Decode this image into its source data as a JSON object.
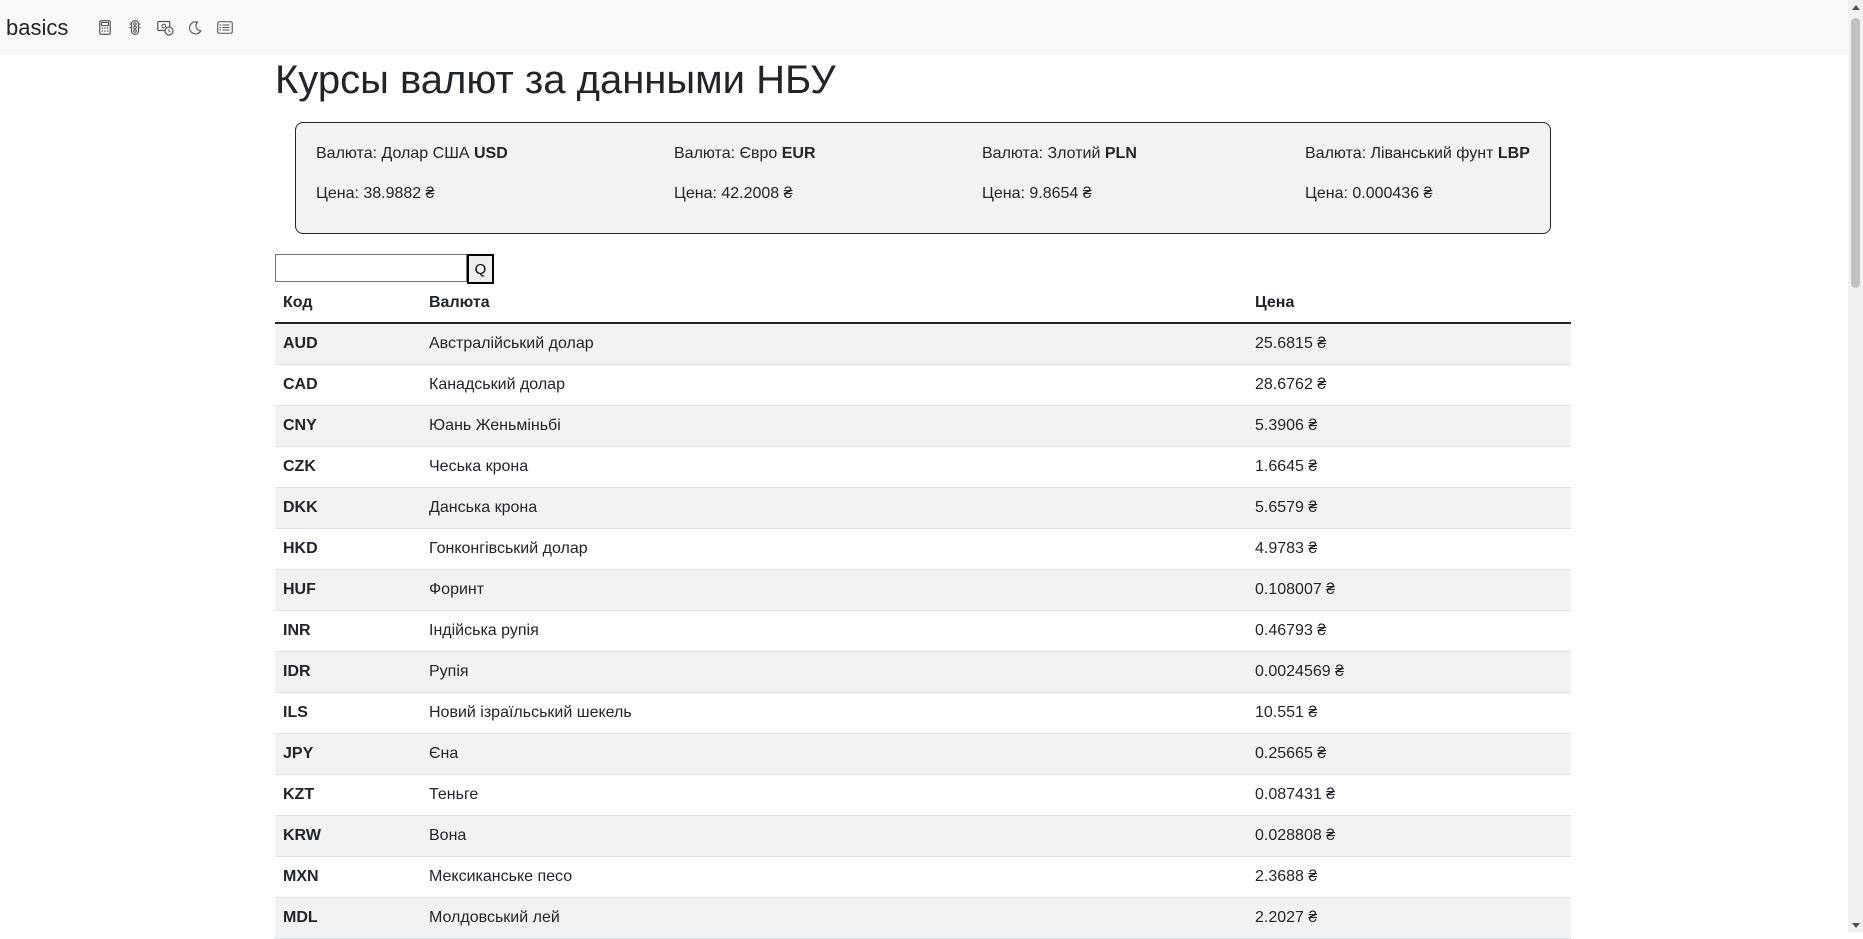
{
  "navbar": {
    "brand": "basics",
    "icons": [
      "calculator-icon",
      "traffic-light-icon",
      "currency-exchange-icon",
      "moon-icon",
      "card-list-icon"
    ]
  },
  "page": {
    "title": "Курсы валют за данными НБУ"
  },
  "featured": [
    {
      "label": "Валюта: Долар США ",
      "code": "USD",
      "price": "Цена: 38.9882 ₴"
    },
    {
      "label": "Валюта: Євро ",
      "code": "EUR",
      "price": "Цена: 42.2008 ₴"
    },
    {
      "label": "Валюта: Злотий ",
      "code": "PLN",
      "price": "Цена: 9.8654 ₴"
    },
    {
      "label": "Валюта: Ліванський фунт ",
      "code": "LBP",
      "price": "Цена: 0.000436 ₴"
    }
  ],
  "search": {
    "value": "",
    "button_label": "Q"
  },
  "table": {
    "headers": [
      "Код",
      "Валюта",
      "Цена"
    ],
    "rows": [
      {
        "code": "AUD",
        "name": "Австралійський долар",
        "price": "25.6815 ₴"
      },
      {
        "code": "CAD",
        "name": "Канадський долар",
        "price": "28.6762 ₴"
      },
      {
        "code": "CNY",
        "name": "Юань Женьміньбі",
        "price": "5.3906 ₴"
      },
      {
        "code": "CZK",
        "name": "Чеська крона",
        "price": "1.6645 ₴"
      },
      {
        "code": "DKK",
        "name": "Данська крона",
        "price": "5.6579 ₴"
      },
      {
        "code": "HKD",
        "name": "Гонконгівський долар",
        "price": "4.9783 ₴"
      },
      {
        "code": "HUF",
        "name": "Форинт",
        "price": "0.108007 ₴"
      },
      {
        "code": "INR",
        "name": "Індійська рупія",
        "price": "0.46793 ₴"
      },
      {
        "code": "IDR",
        "name": "Рупія",
        "price": "0.0024569 ₴"
      },
      {
        "code": "ILS",
        "name": "Новий ізраїльський шекель",
        "price": "10.551 ₴"
      },
      {
        "code": "JPY",
        "name": "Єна",
        "price": "0.25665 ₴"
      },
      {
        "code": "KZT",
        "name": "Теньге",
        "price": "0.087431 ₴"
      },
      {
        "code": "KRW",
        "name": "Вона",
        "price": "0.028808 ₴"
      },
      {
        "code": "MXN",
        "name": "Мексиканське песо",
        "price": "2.3688 ₴"
      },
      {
        "code": "MDL",
        "name": "Молдовський лей",
        "price": "2.2027 ₴"
      }
    ]
  },
  "scrollbar": {
    "position": 0
  }
}
